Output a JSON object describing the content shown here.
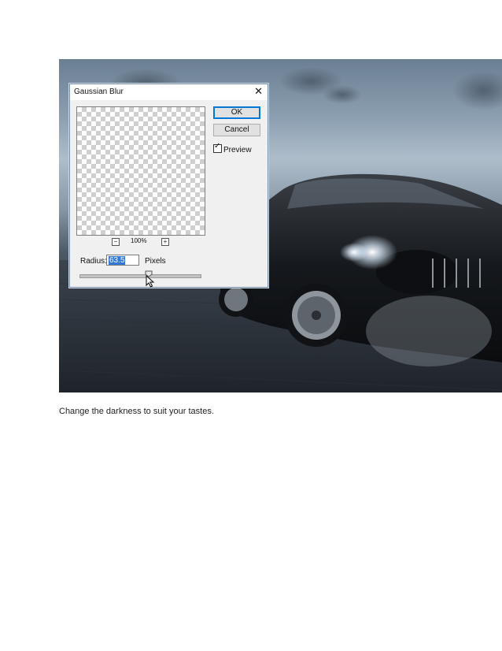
{
  "dialog": {
    "title": "Gaussian Blur",
    "close_glyph": "✕",
    "ok_label": "OK",
    "cancel_label": "Cancel",
    "preview_label": "Preview",
    "preview_checked": true,
    "zoom_level": "100%",
    "zoom_out_glyph": "−",
    "zoom_in_glyph": "+",
    "radius_label": "Radius:",
    "radius_value": "63.5",
    "radius_unit": "Pixels"
  },
  "caption": "Change the darkness to suit your tastes.",
  "icons": {
    "close": "close-icon",
    "zoom_out": "zoom-out-icon",
    "zoom_in": "zoom-in-icon",
    "checkbox": "checkbox-checked-icon",
    "slider_thumb": "slider-thumb-icon",
    "cursor": "mouse-cursor-icon"
  },
  "colors": {
    "ok_border": "#0078d7",
    "selection": "#3478d6"
  }
}
